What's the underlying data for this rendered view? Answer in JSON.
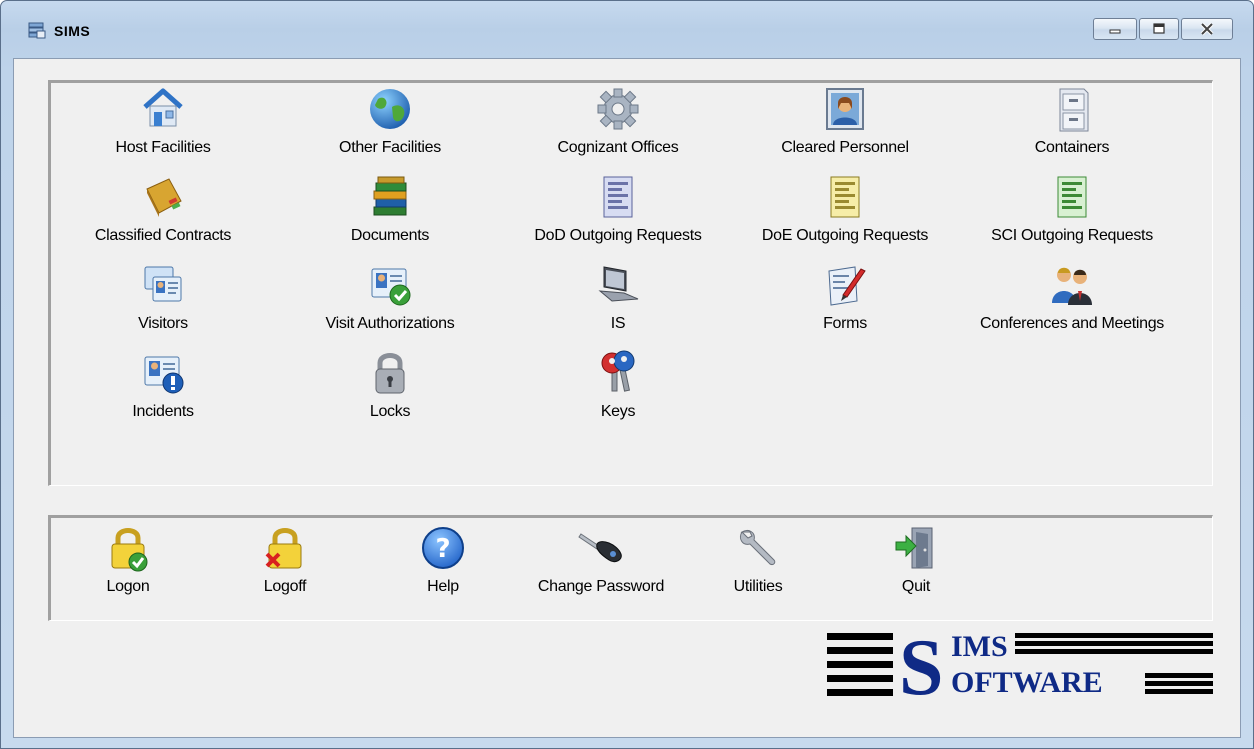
{
  "window": {
    "title": "SIMS",
    "controls": [
      "minimize",
      "maximize",
      "close"
    ]
  },
  "modules": [
    {
      "label": "Host Facilities",
      "icon": "house-icon"
    },
    {
      "label": "Other Facilities",
      "icon": "globe-icon"
    },
    {
      "label": "Cognizant Offices",
      "icon": "gear-icon"
    },
    {
      "label": "Cleared Personnel",
      "icon": "person-photo-icon"
    },
    {
      "label": "Containers",
      "icon": "file-cabinet-icon"
    },
    {
      "label": "Classified Contracts",
      "icon": "notebook-icon"
    },
    {
      "label": "Documents",
      "icon": "books-icon"
    },
    {
      "label": "DoD Outgoing Requests",
      "icon": "blue-form-icon"
    },
    {
      "label": "DoE Outgoing Requests",
      "icon": "yellow-form-icon"
    },
    {
      "label": "SCI Outgoing Requests",
      "icon": "green-form-icon"
    },
    {
      "label": "Visitors",
      "icon": "id-cards-icon"
    },
    {
      "label": "Visit Authorizations",
      "icon": "id-card-check-icon"
    },
    {
      "label": "IS",
      "icon": "laptop-icon"
    },
    {
      "label": "Forms",
      "icon": "form-pen-icon"
    },
    {
      "label": "Conferences and Meetings",
      "icon": "two-people-icon"
    },
    {
      "label": "Incidents",
      "icon": "id-card-alert-icon"
    },
    {
      "label": "Locks",
      "icon": "padlock-icon"
    },
    {
      "label": "Keys",
      "icon": "keys-icon"
    }
  ],
  "actions": [
    {
      "label": "Logon",
      "icon": "lock-check-icon"
    },
    {
      "label": "Logoff",
      "icon": "lock-x-icon"
    },
    {
      "label": "Help",
      "icon": "help-icon"
    },
    {
      "label": "Change Password",
      "icon": "key-icon"
    },
    {
      "label": "Utilities",
      "icon": "wrench-icon"
    },
    {
      "label": "Quit",
      "icon": "exit-door-icon"
    }
  ],
  "logo": {
    "line1": "IMS",
    "line2": "OFTWARE",
    "initial": "S"
  }
}
